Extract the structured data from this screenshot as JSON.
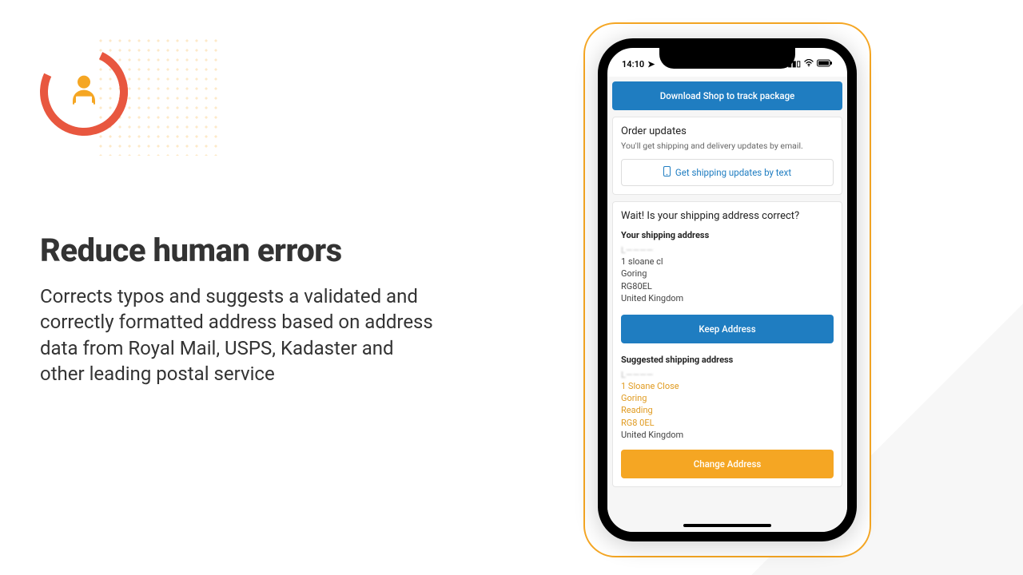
{
  "left": {
    "headline": "Reduce human errors",
    "body": "Corrects typos and suggests a validated and correctly formatted address based on address data from Royal Mail, USPS, Kadaster and other leading postal service"
  },
  "phone": {
    "statusbar": {
      "time": "14:10"
    },
    "download_btn": "Download Shop to track package",
    "order_updates": {
      "title": "Order updates",
      "subtitle": "You'll get shipping and delivery updates by email.",
      "text_btn": "Get shipping updates by text"
    },
    "validation": {
      "title": "Wait! Is your shipping address correct?",
      "your_label": "Your shipping address",
      "your": {
        "name_obscured": "L————",
        "line1": "1 sloane cl",
        "city": "Goring",
        "postcode": "RG80EL",
        "country": "United Kingdom"
      },
      "keep_btn": "Keep Address",
      "suggested_label": "Suggested shipping address",
      "suggested": {
        "name_obscured": "L————",
        "line1": "1 Sloane Close",
        "city": "Goring",
        "region": "Reading",
        "postcode": "RG8 0EL",
        "country": "United Kingdom"
      },
      "change_btn": "Change Address"
    }
  }
}
